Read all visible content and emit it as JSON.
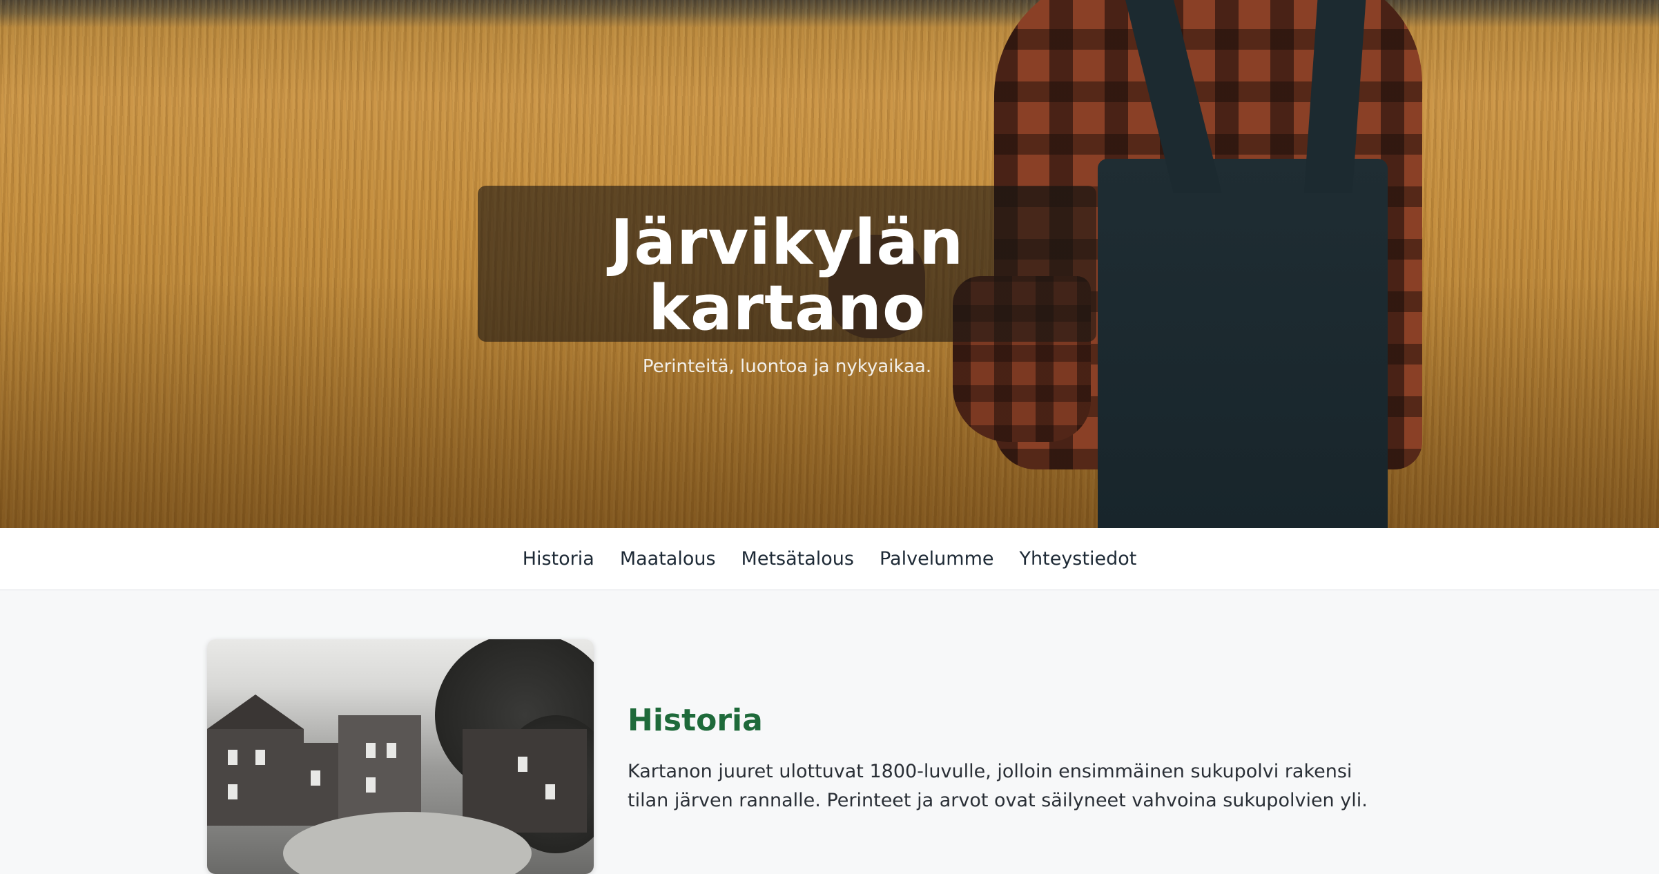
{
  "hero": {
    "title": "Järvikylän kartano",
    "subtitle": "Perinteitä, luontoa ja nykyaikaa."
  },
  "nav": {
    "items": [
      "Historia",
      "Maatalous",
      "Metsätalous",
      "Palvelumme",
      "Yhteystiedot"
    ]
  },
  "history": {
    "heading": "Historia",
    "body": "Kartanon juuret ulottuvat 1800-luvulle, jolloin ensimmäinen sukupolvi rakensi tilan järven rannalle. Perinteet ja arvot ovat säilyneet vahvoina sukupolvien yli."
  },
  "colors": {
    "accent_green": "#1e6a3a",
    "nav_text": "#1e2a36",
    "page_bg": "#f7f8f9"
  }
}
